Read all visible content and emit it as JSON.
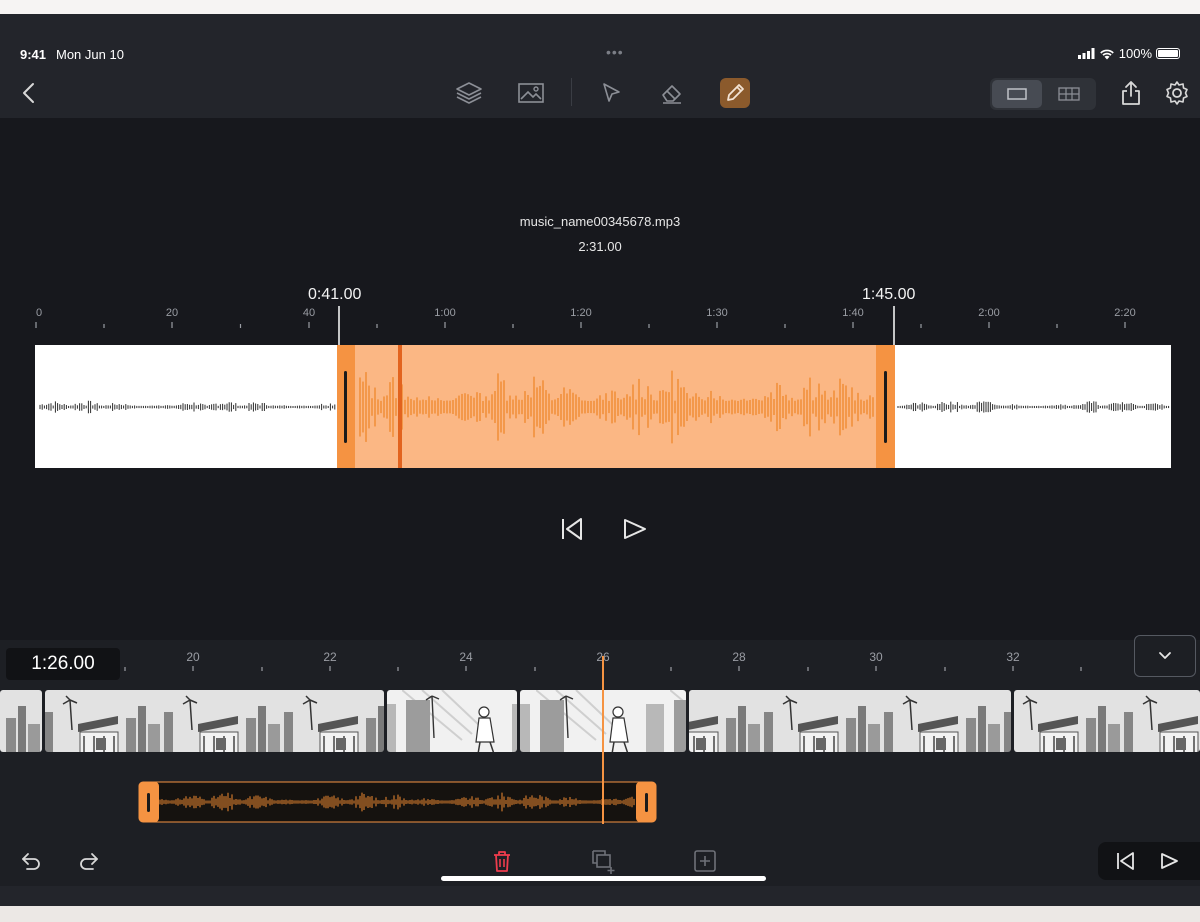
{
  "status": {
    "time": "9:41",
    "date": "Mon Jun 10",
    "dots": "•••",
    "battery": "100%"
  },
  "toolbar": {
    "icons": [
      "back-chevron-icon",
      "layers-icon",
      "image-icon",
      "pointer-icon",
      "eraser-icon",
      "pencil-icon",
      "single-view-icon",
      "grid-view-icon",
      "share-icon",
      "settings-gear-icon"
    ],
    "active_tool": "pencil",
    "accent": "#f59342"
  },
  "audio": {
    "filename": "music_name00345678.mp3",
    "duration": "2:31.00",
    "selection_start": "0:41.00",
    "selection_end": "1:45.00",
    "ruler_labels": [
      "0",
      "20",
      "40",
      "1:00",
      "1:20",
      "1:30",
      "1:40",
      "2:00",
      "2:20"
    ]
  },
  "timeline": {
    "current_time": "1:26.00",
    "frame_labels": [
      "20",
      "22",
      "24",
      "26",
      "28",
      "30",
      "32"
    ]
  },
  "colors": {
    "accent": "#f59342",
    "background": "#17181d",
    "panel": "#23252b",
    "delete": "#ef3c4d"
  }
}
